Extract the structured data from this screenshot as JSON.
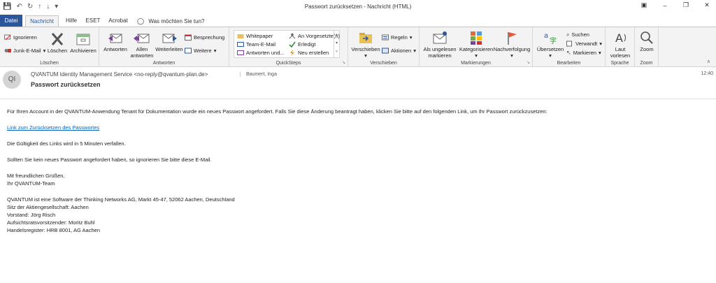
{
  "window": {
    "title": "Passwort zurücksetzen  -  Nachricht (HTML)"
  },
  "tabs": [
    {
      "label": "Datei"
    },
    {
      "label": "Nachricht"
    },
    {
      "label": "Hilfe"
    },
    {
      "label": "ESET"
    },
    {
      "label": "Acrobat"
    },
    {
      "label": "Was möchten Sie tun?"
    }
  ],
  "ribbon": {
    "loeschen": {
      "label": "Löschen",
      "ignorieren": "Ignorieren",
      "junk": "Junk-E-Mail",
      "loeschen_btn": "Löschen",
      "archivieren": "Archivieren"
    },
    "antworten": {
      "label": "Antworten",
      "antworten_btn": "Antworten",
      "allen1": "Allen",
      "allen2": "antworten",
      "weiterleiten": "Weiterleiten",
      "besprechung": "Besprechung",
      "weitere": "Weitere"
    },
    "quicksteps": {
      "label": "QuickSteps",
      "items": [
        "Whitepaper",
        "Team-E-Mail",
        "Antworten und...",
        "An Vorgesetzte(n)",
        "Erledigt",
        "Neu erstellen"
      ]
    },
    "verschieben": {
      "label": "Verschieben",
      "verschieben_btn": "Verschieben",
      "regeln": "Regeln",
      "aktionen": "Aktionen"
    },
    "markierungen": {
      "label": "Markierungen",
      "ungelesen1": "Als ungelesen",
      "ungelesen2": "markieren",
      "kategorisieren": "Kategorisieren",
      "nachverfolgung": "Nachverfolgung"
    },
    "bearbeiten": {
      "label": "Bearbeiten",
      "uebersetzen": "Übersetzen",
      "suchen": "Suchen",
      "verwandt": "Verwandt",
      "markieren": "Markieren"
    },
    "sprache": {
      "label": "Sprache",
      "laut1": "Laut",
      "laut2": "vorlesen"
    },
    "zoom": {
      "label": "Zoom",
      "zoom_btn": "Zoom"
    }
  },
  "message": {
    "avatar_initials": "QI",
    "sender": "QVANTUM Identity Management Service <no-reply@qvantum-plan.de>",
    "recipient": "Baumert, Inga",
    "subject": "Passwort zurücksetzen",
    "time": "12:40",
    "body": {
      "p1": "Für Ihren Account in der QVANTUM-Anwendung Tenant für Dokumentation wurde ein neues Passwort angefordert. Falls Sie diese Änderung beantragt haben, klicken Sie bitte auf den folgenden Link, um Ihr Passwort zurückzusetzen:",
      "link": "Link zum Zurücksetzen des Passwortes",
      "p2": "Die Gültigkeit des Links wird in 5 Minuten verfallen.",
      "p3": "Sollten Sie kein neues Passwort angefordert haben, so ignorieren Sie bitte diese E-Mail.",
      "greeting": "Mit freundlichen Grüßen,",
      "signoff": "Ihr QVANTUM-Team",
      "footer": [
        "QVANTUM ist eine Software der Thinking Networks AG, Markt 45-47, 52062 Aachen, Deutschland",
        "Sitz der Aktiengesellschaft: Aachen",
        "Vorstand: Jörg Risch",
        "Aufsichtsratsvorsitzender: Moritz Buhl",
        "Handelsregister: HRB 8001, AG Aachen"
      ]
    }
  },
  "colors": {
    "accent": "#2b579a",
    "link": "#0563c1",
    "ribbon_bg": "#f3f3f3"
  }
}
